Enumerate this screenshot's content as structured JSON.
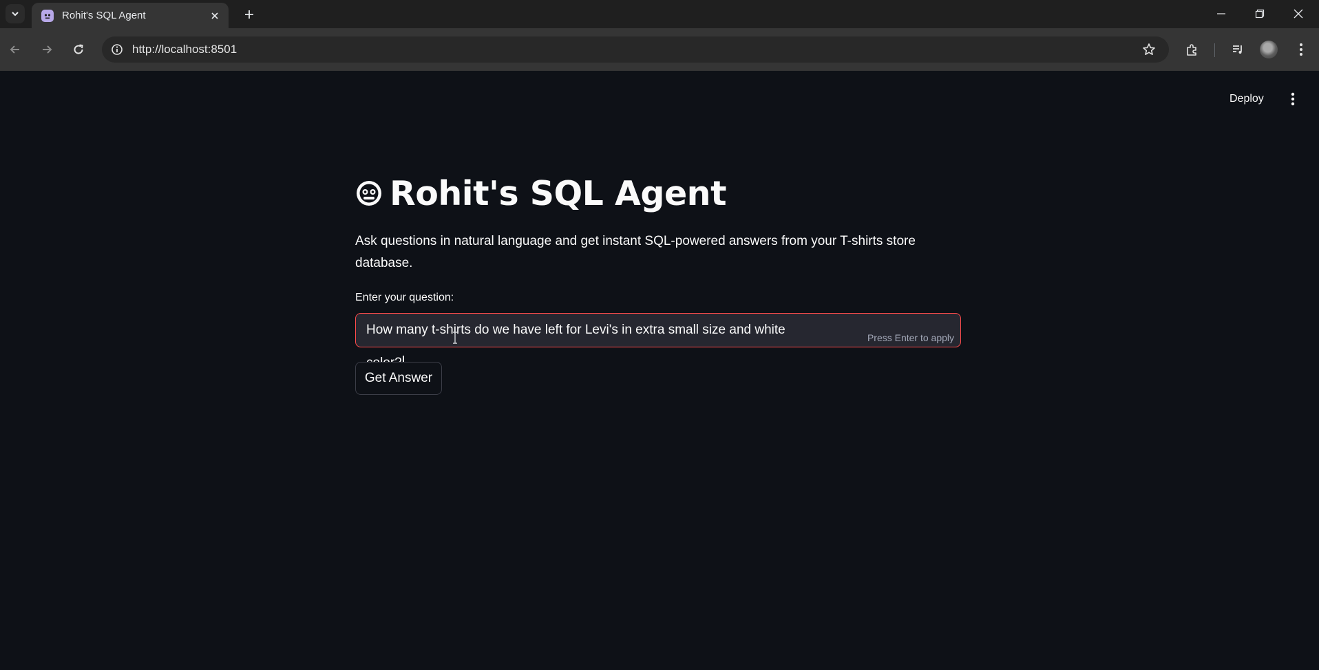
{
  "browser": {
    "tab": {
      "title": "Rohit's SQL Agent",
      "favicon": "robot-face-icon"
    },
    "url": "http://localhost:8501"
  },
  "app": {
    "deploy_label": "Deploy",
    "title": "Rohit's SQL Agent",
    "title_icon": "robot-face-icon",
    "subtitle": "Ask questions in natural language and get instant SQL-powered answers from your T-shirts store database.",
    "question_label": "Enter your question:",
    "question_value": "How many t-shirts do we have left for Levi's in extra small size and white color?",
    "input_hint": "Press Enter to apply",
    "submit_label": "Get Answer"
  },
  "colors": {
    "background": "#0e1117",
    "text": "#fafafa",
    "input_background": "#262730",
    "focus_accent": "#ff4b4b"
  }
}
